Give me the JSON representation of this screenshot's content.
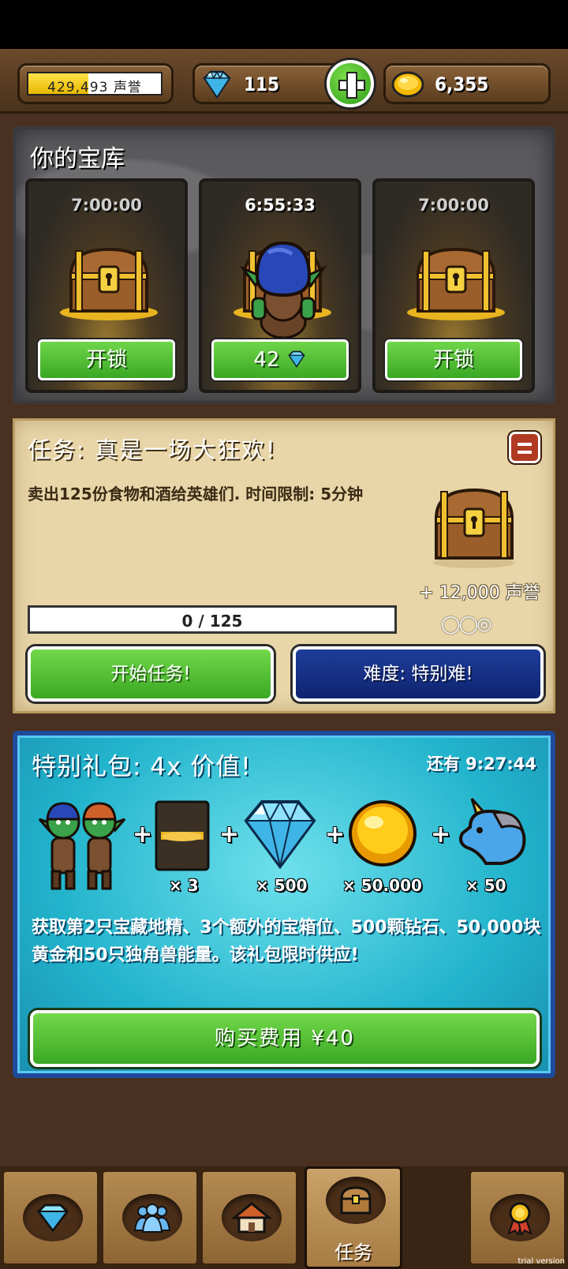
{
  "resources": {
    "reputation": {
      "value": "429,493 声誉",
      "fill": 0.45
    },
    "gems": {
      "value": "115",
      "icon": "diamond-icon"
    },
    "gold": {
      "value": "6,355",
      "icon": "gold-coin-icon"
    }
  },
  "vault": {
    "title": "你的宝库",
    "slots": [
      {
        "timer": "7:00:00",
        "button": "开锁"
      },
      {
        "timer": "6:55:33",
        "button": "42"
      },
      {
        "timer": "7:00:00",
        "button": "开锁"
      }
    ]
  },
  "quest": {
    "title": "任务: 真是一场大狂欢!",
    "description": "卖出125份食物和酒给英雄们. 时间限制: 5分钟",
    "reward": "+ 12,000 声誉",
    "stars": "◯◯◎",
    "progress_text": "0 / 125",
    "progress_fraction": 0,
    "start_button": "开始任务!",
    "difficulty_button": "难度: 特别难!"
  },
  "pack": {
    "title": "特别礼包: 4x 价值!",
    "timer": "还有 9:27:44",
    "items": [
      {
        "icon": "goblin-pair-icon",
        "count": ""
      },
      {
        "icon": "vault-slot-card-icon",
        "count": "× 3"
      },
      {
        "icon": "diamond-icon",
        "count": "× 500"
      },
      {
        "icon": "gold-coin-icon",
        "count": "× 50.000"
      },
      {
        "icon": "unicorn-icon",
        "count": "× 50"
      }
    ],
    "description": "获取第2只宝藏地精、3个额外的宝箱位、500颗钻石、50,000块黄金和50只独角兽能量。该礼包限时供应!",
    "buy_button": "购买费用 ¥40"
  },
  "nav": {
    "tabs": [
      {
        "icon": "diamond-icon",
        "label": ""
      },
      {
        "icon": "people-icon",
        "label": ""
      },
      {
        "icon": "house-icon",
        "label": ""
      },
      {
        "icon": "chest-icon",
        "label": "任务"
      },
      {
        "icon": "medal-icon",
        "label": ""
      }
    ]
  },
  "watermark": "trial version",
  "colors": {
    "green_button": "#3aa823",
    "blue_button": "#0f2470",
    "pack_bg": "#22b4cc"
  }
}
